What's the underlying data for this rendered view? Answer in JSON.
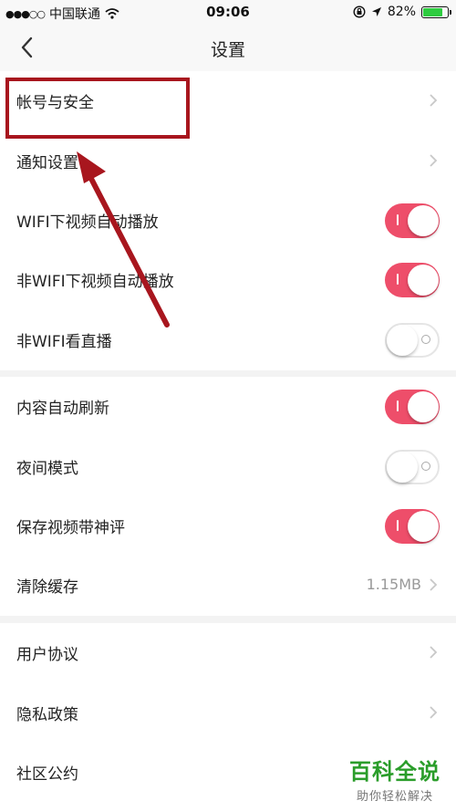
{
  "status_bar": {
    "signal_dots": "●●●○○",
    "carrier": "中国联通",
    "time": "09:06",
    "battery": "82%",
    "battery_level": 0.82,
    "battery_color": "#2ecc40"
  },
  "nav": {
    "title": "设置"
  },
  "groups": [
    {
      "rows": [
        {
          "label": "帐号与安全",
          "control": "chevron"
        },
        {
          "label": "通知设置",
          "control": "chevron"
        },
        {
          "label": "WIFI下视频自动播放",
          "control": "toggle",
          "on": true
        },
        {
          "label": "非WIFI下视频自动播放",
          "control": "toggle",
          "on": true
        },
        {
          "label": "非WIFI看直播",
          "control": "toggle",
          "on": false
        }
      ]
    },
    {
      "rows": [
        {
          "label": "内容自动刷新",
          "control": "toggle",
          "on": true
        },
        {
          "label": "夜间模式",
          "control": "toggle",
          "on": false
        },
        {
          "label": "保存视频带神评",
          "control": "toggle",
          "on": true
        },
        {
          "label": "清除缓存",
          "control": "value_chevron",
          "value": "1.15MB"
        }
      ]
    },
    {
      "rows": [
        {
          "label": "用户协议",
          "control": "chevron"
        },
        {
          "label": "隐私政策",
          "control": "chevron"
        },
        {
          "label": "社区公约",
          "control": "chevron"
        }
      ]
    }
  ],
  "watermark": {
    "title": "百科全说",
    "subtitle": "助你轻松解决"
  },
  "colors": {
    "accent": "#ee4e6a",
    "annotation": "#a8161e",
    "watermark": "#2a9d2a"
  }
}
